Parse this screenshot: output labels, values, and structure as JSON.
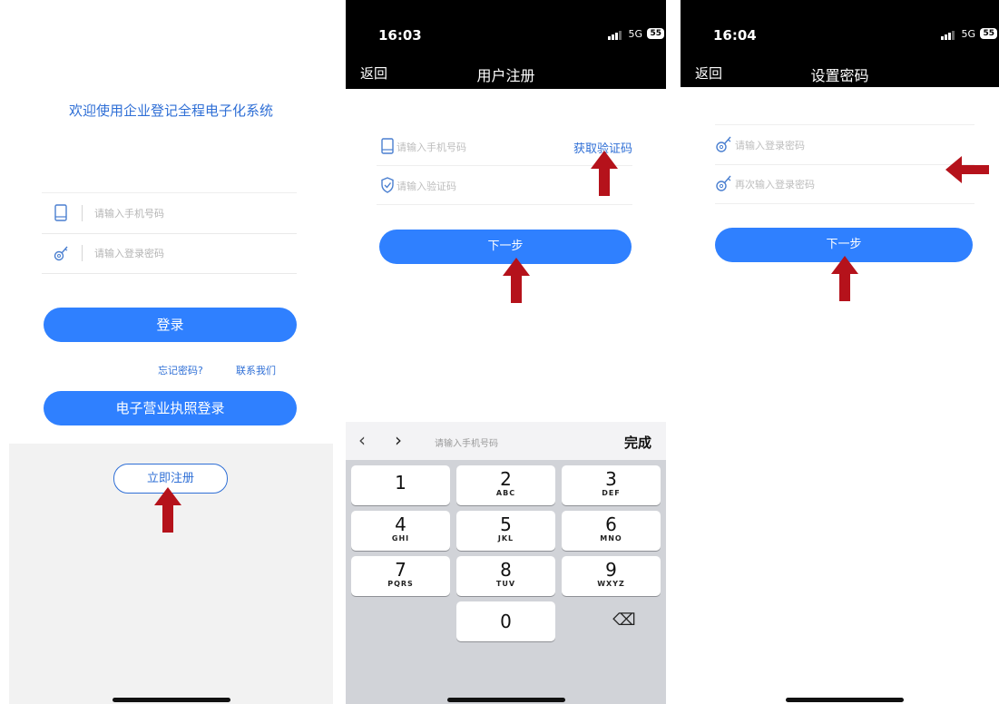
{
  "colors": {
    "primary": "#2f80ff",
    "link": "#2f6fd6",
    "arrow": "#b5121b"
  },
  "login_screen": {
    "welcome": "欢迎使用企业登记全程电子化系统",
    "phone_placeholder": "请输入手机号码",
    "password_placeholder": "请输入登录密码",
    "login_button": "登录",
    "forgot_password": "忘记密码?",
    "contact_us": "联系我们",
    "e_license_button": "电子营业执照登录",
    "register_button": "立即注册",
    "icons": {
      "phone": "phone-icon",
      "password": "key-icon"
    }
  },
  "register_screen": {
    "status": {
      "time": "16:03",
      "network": "5G",
      "battery": "55"
    },
    "back": "返回",
    "title": "用户注册",
    "phone_placeholder": "请输入手机号码",
    "get_code": "获取验证码",
    "code_placeholder": "请输入验证码",
    "next_button": "下一步",
    "keyboard": {
      "placeholder": "请输入手机号码",
      "done": "完成",
      "keys": [
        {
          "num": "1",
          "letters": ""
        },
        {
          "num": "2",
          "letters": "ABC"
        },
        {
          "num": "3",
          "letters": "DEF"
        },
        {
          "num": "4",
          "letters": "GHI"
        },
        {
          "num": "5",
          "letters": "JKL"
        },
        {
          "num": "6",
          "letters": "MNO"
        },
        {
          "num": "7",
          "letters": "PQRS"
        },
        {
          "num": "8",
          "letters": "TUV"
        },
        {
          "num": "9",
          "letters": "WXYZ"
        },
        {
          "num": "0",
          "letters": ""
        }
      ]
    }
  },
  "password_screen": {
    "status": {
      "time": "16:04",
      "network": "5G",
      "battery": "55"
    },
    "back": "返回",
    "title": "设置密码",
    "password_placeholder": "请输入登录密码",
    "confirm_placeholder": "再次输入登录密码",
    "next_button": "下一步"
  }
}
